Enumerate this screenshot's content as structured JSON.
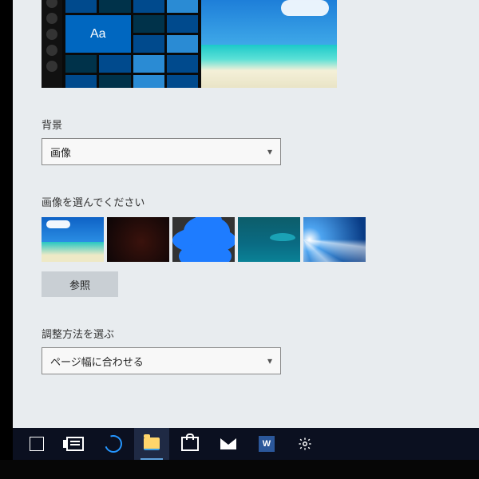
{
  "preview": {
    "tile_label": "Aa"
  },
  "background_section": {
    "label": "背景",
    "selected": "画像"
  },
  "choose_image": {
    "label": "画像を選んでください",
    "browse_label": "参照",
    "thumbs": [
      "thumb-1",
      "thumb-2",
      "thumb-3",
      "thumb-4",
      "thumb-5"
    ]
  },
  "fit_section": {
    "label": "調整方法を選ぶ",
    "selected": "ページ幅に合わせる"
  },
  "taskbar": {
    "word_glyph": "W"
  }
}
